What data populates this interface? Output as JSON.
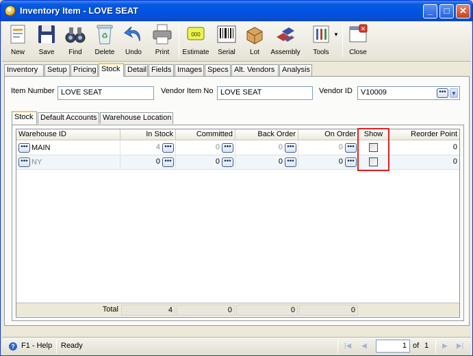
{
  "window": {
    "title": "Inventory Item - LOVE SEAT",
    "controls": [
      "_",
      "□",
      "✕"
    ]
  },
  "toolbar": [
    {
      "label": "New",
      "icon": "new-document-icon"
    },
    {
      "label": "Save",
      "icon": "floppy-disk-icon"
    },
    {
      "label": "Find",
      "icon": "binoculars-icon"
    },
    {
      "label": "Delete",
      "icon": "recycle-bin-icon"
    },
    {
      "label": "Undo",
      "icon": "undo-arrow-icon"
    },
    {
      "label": "Print",
      "icon": "printer-icon"
    },
    {
      "label": "Estimate",
      "icon": "estimate-icon"
    },
    {
      "label": "Serial",
      "icon": "barcode-icon"
    },
    {
      "label": "Lot",
      "icon": "boxes-icon"
    },
    {
      "label": "Assembly",
      "icon": "assembly-icon"
    },
    {
      "label": "Tools",
      "icon": "tools-icon"
    },
    {
      "label": "Close",
      "icon": "close-window-icon"
    }
  ],
  "tabs": [
    "Inventory",
    "Setup",
    "Pricing",
    "Stock",
    "Detail",
    "Fields",
    "Images",
    "Specs",
    "Alt. Vendors",
    "Analysis"
  ],
  "active_tab": "Stock",
  "form": {
    "item_number_label": "Item Number",
    "item_number": "LOVE SEAT",
    "vendor_item_no_label": "Vendor Item No",
    "vendor_item_no": "LOVE SEAT",
    "vendor_id_label": "Vendor ID",
    "vendor_id": "V10009"
  },
  "subtabs": [
    "Stock",
    "Default Accounts",
    "Warehouse Location"
  ],
  "grid": {
    "columns": [
      "Warehouse ID",
      "In Stock",
      "Committed",
      "Back Order",
      "On Order",
      "Show",
      "Reorder Point"
    ],
    "rows": [
      {
        "warehouse": "MAIN",
        "in_stock": "4",
        "committed": "0",
        "back_order": "0",
        "on_order": "0",
        "show": false,
        "reorder_point": "0"
      },
      {
        "warehouse": "NY",
        "in_stock": "0",
        "committed": "0",
        "back_order": "0",
        "on_order": "0",
        "show": false,
        "reorder_point": "0"
      }
    ],
    "totals": {
      "label": "Total",
      "in_stock": "4",
      "committed": "0",
      "back_order": "0",
      "on_order": "0"
    }
  },
  "status": {
    "help": "F1 - Help",
    "state": "Ready",
    "page": "1",
    "of_label": "of",
    "total_pages": "1"
  }
}
